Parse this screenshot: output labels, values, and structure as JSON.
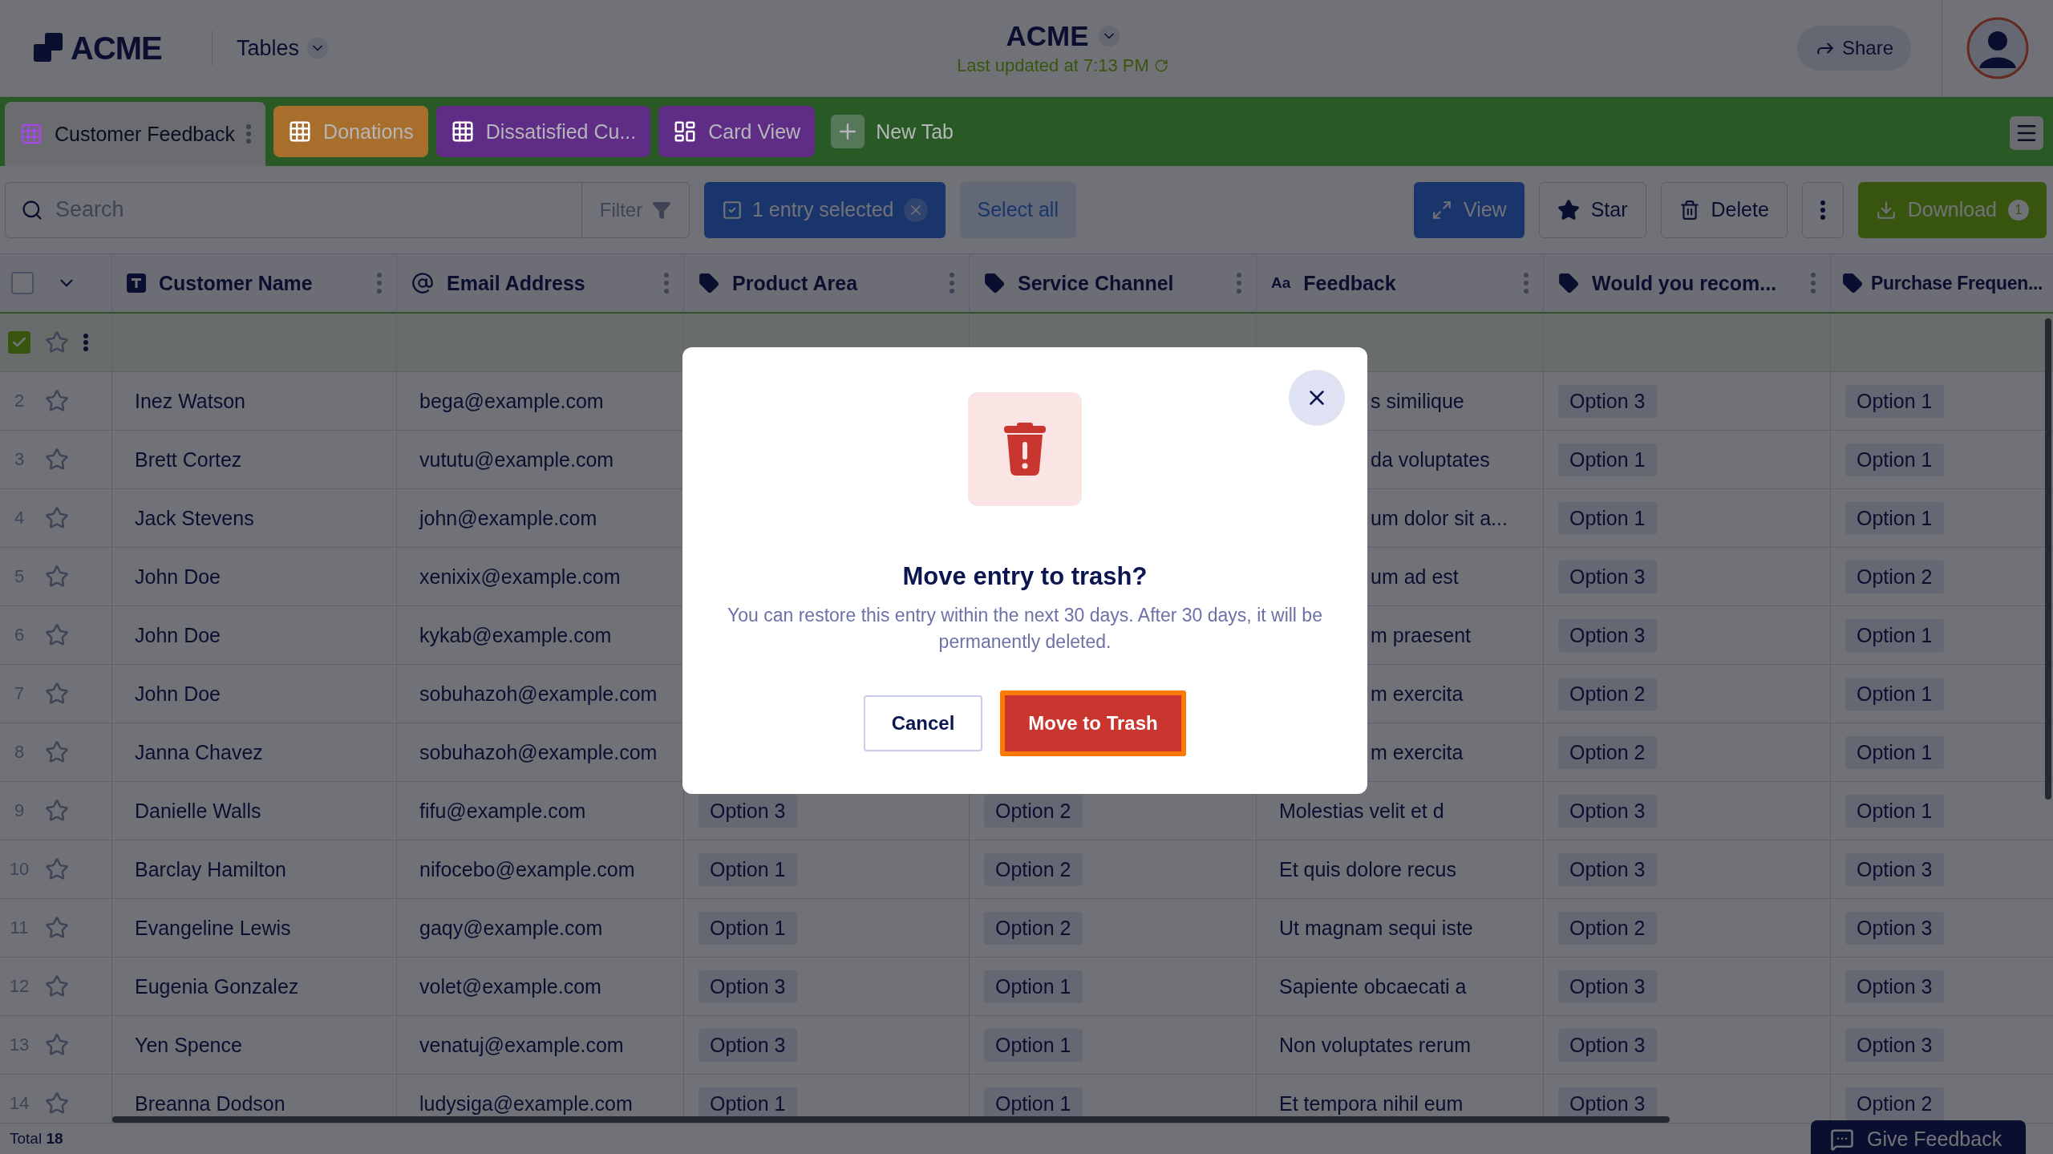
{
  "header": {
    "logo": "ACME",
    "menu": "Tables",
    "title": "ACME",
    "updated": "Last updated at 7:13 PM",
    "share": "Share"
  },
  "tabs": [
    {
      "label": "Customer Feedback",
      "kind": "table",
      "selected": true,
      "color": "#6b6c70"
    },
    {
      "label": "Donations",
      "kind": "table",
      "selected": false,
      "color": "#a86f2c"
    },
    {
      "label": "Dissatisfied Cu...",
      "kind": "table",
      "selected": false,
      "color": "#5f2c86"
    },
    {
      "label": "Card View",
      "kind": "cards",
      "selected": false,
      "color": "#5f2c86"
    }
  ],
  "new_tab": "New Tab",
  "toolbar": {
    "search_placeholder": "Search",
    "filter": "Filter",
    "selection": "1 entry selected",
    "select_all": "Select all",
    "view": "View",
    "star": "Star",
    "delete": "Delete",
    "download": "Download",
    "download_badge": "1"
  },
  "table": {
    "select_all_checked": false,
    "columns": [
      {
        "label": "Customer Name",
        "kind": "text"
      },
      {
        "label": "Email Address",
        "kind": "email"
      },
      {
        "label": "Product Area",
        "kind": "tag"
      },
      {
        "label": "Service Channel",
        "kind": "tag"
      },
      {
        "label": "Feedback",
        "kind": "long",
        "icon_text": "Aa"
      },
      {
        "label": "Would you recom...",
        "kind": "tag"
      },
      {
        "label": "Purchase Frequen...",
        "kind": "tag"
      }
    ],
    "rows": [
      {
        "checked": true,
        "starred": false
      },
      {
        "number": "2",
        "checked": false,
        "starred": false,
        "cells": [
          "Inez Watson",
          "bega@example.com",
          null,
          null,
          "s similique",
          "Option 3",
          "Option 1"
        ]
      },
      {
        "number": "3",
        "checked": false,
        "starred": false,
        "cells": [
          "Brett Cortez",
          "vututu@example.com",
          null,
          null,
          "da voluptates",
          "Option 1",
          "Option 1"
        ]
      },
      {
        "number": "4",
        "checked": false,
        "starred": false,
        "cells": [
          "Jack Stevens",
          "john@example.com",
          null,
          null,
          "um dolor sit a...",
          "Option 1",
          "Option 1"
        ]
      },
      {
        "number": "5",
        "checked": false,
        "starred": false,
        "cells": [
          "John Doe",
          "xenixix@example.com",
          null,
          null,
          "um ad est",
          "Option 3",
          "Option 2"
        ]
      },
      {
        "number": "6",
        "checked": false,
        "starred": false,
        "cells": [
          "John Doe",
          "kykab@example.com",
          null,
          null,
          "m praesent",
          "Option 3",
          "Option 1"
        ]
      },
      {
        "number": "7",
        "checked": false,
        "starred": false,
        "cells": [
          "John Doe",
          "sobuhazoh@example.com",
          null,
          null,
          "m exercita",
          "Option 2",
          "Option 1"
        ]
      },
      {
        "number": "8",
        "checked": false,
        "starred": false,
        "cells": [
          "Janna Chavez",
          "sobuhazoh@example.com",
          null,
          null,
          "m exercita",
          "Option 2",
          "Option 1"
        ]
      },
      {
        "number": "9",
        "checked": false,
        "starred": false,
        "cells": [
          "Danielle Walls",
          "fifu@example.com",
          "Option 3",
          "Option 2",
          "Molestias velit et d",
          "Option 3",
          "Option 1"
        ]
      },
      {
        "number": "10",
        "checked": false,
        "starred": false,
        "cells": [
          "Barclay Hamilton",
          "nifocebo@example.com",
          "Option 1",
          "Option 2",
          "Et quis dolore recus",
          "Option 3",
          "Option 3"
        ]
      },
      {
        "number": "11",
        "checked": false,
        "starred": false,
        "cells": [
          "Evangeline Lewis",
          "gaqy@example.com",
          "Option 1",
          "Option 2",
          "Ut magnam sequi iste",
          "Option 2",
          "Option 3"
        ]
      },
      {
        "number": "12",
        "checked": false,
        "starred": false,
        "cells": [
          "Eugenia Gonzalez",
          "volet@example.com",
          "Option 3",
          "Option 1",
          "Sapiente obcaecati a",
          "Option 3",
          "Option 3"
        ]
      },
      {
        "number": "13",
        "checked": false,
        "starred": false,
        "cells": [
          "Yen Spence",
          "venatuj@example.com",
          "Option 3",
          "Option 1",
          "Non voluptates rerum",
          "Option 3",
          "Option 3"
        ]
      },
      {
        "number": "14",
        "checked": false,
        "starred": false,
        "cells": [
          "Breanna Dodson",
          "ludysiga@example.com",
          "Option 1",
          "Option 1",
          "Et tempora nihil eum",
          "Option 3",
          "Option 2"
        ]
      }
    ]
  },
  "footer": {
    "total_label": "Total",
    "total": "18",
    "feedback_button": "Give Feedback"
  },
  "dialog": {
    "title": "Move entry to trash?",
    "message": "You can restore this entry within the next 30 days. After 30 days, it will be permanently deleted.",
    "cancel": "Cancel",
    "confirm": "Move to Trash"
  }
}
